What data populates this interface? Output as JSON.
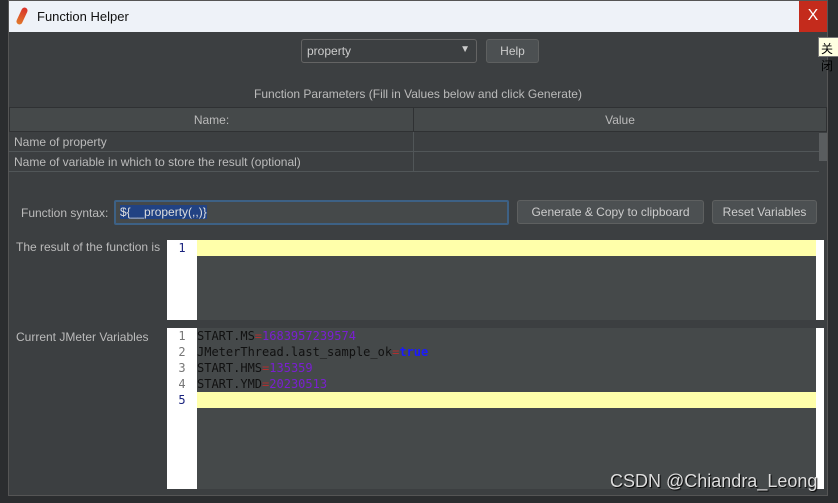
{
  "window": {
    "title": "Function Helper",
    "close_label": "X",
    "close_tooltip": "关闭"
  },
  "function_select": {
    "value": "property",
    "help_label": "Help"
  },
  "parameters": {
    "title": "Function Parameters (Fill in Values below and click Generate)",
    "columns": [
      "Name:",
      "Value"
    ],
    "rows": [
      {
        "name": "Name of property",
        "value": ""
      },
      {
        "name": "Name of variable in which to store the result (optional)",
        "value": ""
      }
    ]
  },
  "syntax": {
    "label": "Function syntax:",
    "value": "${__property(,,)}",
    "generate_label": "Generate & Copy to clipboard",
    "reset_label": "Reset Variables"
  },
  "result": {
    "label": "The result of the function is",
    "lines": [
      "1"
    ]
  },
  "variables": {
    "label": "Current JMeter Variables",
    "lines": [
      {
        "n": "1",
        "key": "START.MS",
        "eq": "=",
        "val": "1683957239574",
        "type": "num"
      },
      {
        "n": "2",
        "key": "JMeterThread.last_sample_ok",
        "eq": "=",
        "val": "true",
        "type": "kw"
      },
      {
        "n": "3",
        "key": "START.HMS",
        "eq": "=",
        "val": "135359",
        "type": "num"
      },
      {
        "n": "4",
        "key": "START.YMD",
        "eq": "=",
        "val": "20230513",
        "type": "num"
      },
      {
        "n": "5",
        "key": "",
        "eq": "",
        "val": "",
        "type": ""
      }
    ]
  },
  "watermark": "CSDN @Chiandra_Leong"
}
